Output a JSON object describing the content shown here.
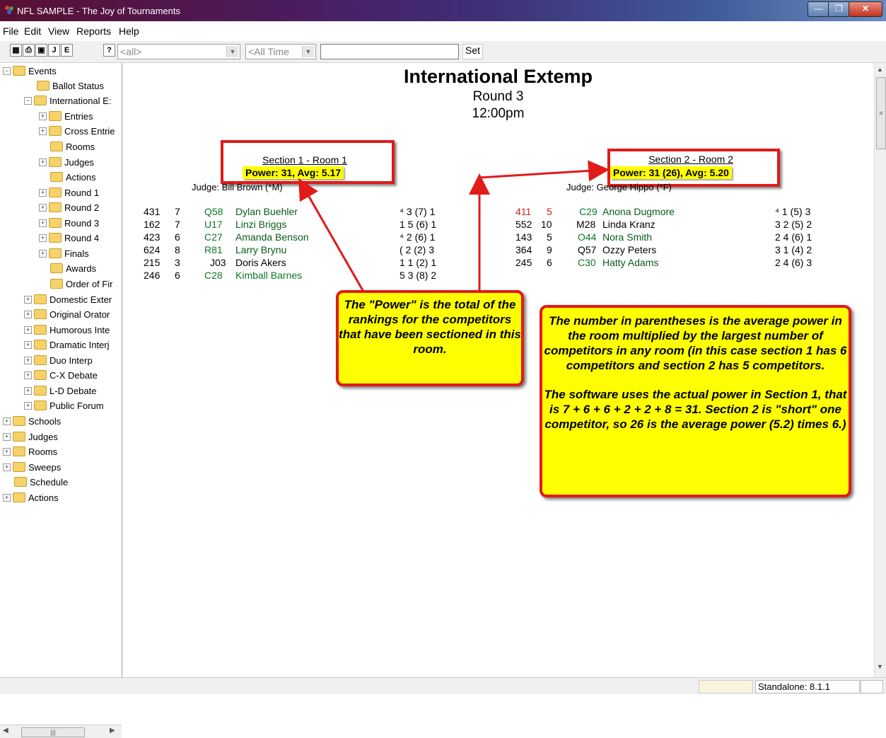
{
  "window": {
    "title": "NFL SAMPLE - The Joy of Tournaments"
  },
  "menu": [
    "File",
    "Edit",
    "View",
    "Reports",
    "Help"
  ],
  "toolbar": {
    "buttons": [
      "save",
      "print",
      "preview",
      "J",
      "E",
      "?"
    ],
    "filter_combo": "<all>",
    "time_combo": "<All Time",
    "set_label": "Set"
  },
  "tree": [
    {
      "label": "Events",
      "expander": "−"
    },
    {
      "label": "Ballot Status"
    },
    {
      "label": "International E:",
      "expander": "−"
    },
    {
      "label": "Entries",
      "expander": "+"
    },
    {
      "label": "Cross Entrie",
      "expander": "+"
    },
    {
      "label": "Rooms"
    },
    {
      "label": "Judges",
      "expander": "+"
    },
    {
      "label": "Actions"
    },
    {
      "label": "Round 1",
      "expander": "+"
    },
    {
      "label": "Round 2",
      "expander": "+"
    },
    {
      "label": "Round 3",
      "expander": "+"
    },
    {
      "label": "Round 4",
      "expander": "+"
    },
    {
      "label": "Finals",
      "expander": "+"
    },
    {
      "label": "Awards"
    },
    {
      "label": "Order of Fir"
    },
    {
      "label": "Domestic Exter",
      "expander": "+"
    },
    {
      "label": "Original Orator",
      "expander": "+"
    },
    {
      "label": "Humorous Inte",
      "expander": "+"
    },
    {
      "label": "Dramatic Interj",
      "expander": "+"
    },
    {
      "label": "Duo Interp",
      "expander": "+"
    },
    {
      "label": "C-X Debate",
      "expander": "+"
    },
    {
      "label": "L-D Debate",
      "expander": "+"
    },
    {
      "label": "Public Forum",
      "expander": "+"
    },
    {
      "label": "Schools",
      "expander": "+"
    },
    {
      "label": "Judges",
      "expander": "+"
    },
    {
      "label": "Rooms",
      "expander": "+"
    },
    {
      "label": "Sweeps",
      "expander": "+"
    },
    {
      "label": "Schedule"
    },
    {
      "label": "Actions",
      "expander": "+"
    }
  ],
  "report": {
    "title": "International Extemp",
    "round": "Round 3",
    "time": "12:00pm",
    "sections": [
      {
        "heading": "Section 1 - Room 1",
        "power": "Power: 31,  Avg: 5.17",
        "judge": "Judge: Bill Brown (*M)",
        "rows": [
          {
            "num": "431",
            "power": "7",
            "code": "Q58",
            "name": "Dylan Buehler",
            "record": "⁴ 3 (7) 1"
          },
          {
            "num": "162",
            "power": "7",
            "code": "U17",
            "name": "Linzi Briggs",
            "record": "1 5 (6) 1"
          },
          {
            "num": "423",
            "power": "6",
            "code": "C27",
            "name": "Amanda Benson",
            "record": "⁴ 2 (6) 1"
          },
          {
            "num": "624",
            "power": "8",
            "code": "R81",
            "name": "Larry Brynu",
            "record": "( 2 (2) 3"
          },
          {
            "num": "215",
            "power": "3",
            "code": "J03",
            "name": "Doris Akers",
            "record": "1 1 (2) 1"
          },
          {
            "num": "246",
            "power": "6",
            "code": "C28",
            "name": "Kimball Barnes",
            "record": "5 3 (8) 2"
          }
        ]
      },
      {
        "heading": "Section 2 - Room 2",
        "power": "Power: 31 (26),  Avg: 5.20",
        "judge": "Judge: George Hippo (*F)",
        "rows": [
          {
            "num": "411",
            "power": "5",
            "code": "C29",
            "name": "Anona Dugmore",
            "record": "⁴ 1 (5) 3"
          },
          {
            "num": "552",
            "power": "10",
            "code": "M28",
            "name": "Linda Kranz",
            "record": "3 2 (5) 2"
          },
          {
            "num": "143",
            "power": "5",
            "code": "O44",
            "name": "Nora Smith",
            "record": "2 4 (6) 1"
          },
          {
            "num": "364",
            "power": "9",
            "code": "Q57",
            "name": "Ozzy Peters",
            "record": "3 1 (4) 2"
          },
          {
            "num": "245",
            "power": "6",
            "code": "C30",
            "name": "Hatty Adams",
            "record": "2 4 (6) 3"
          }
        ]
      }
    ]
  },
  "callouts": {
    "power": "The \"Power\" is the total of the rankings for the competitors that have been sectioned in this room.",
    "parentheses_1": "The number in parentheses is the average power in the room multiplied by the largest number of competitors in any room (in this case section 1 has 6 competitors and section 2 has 5 competitors.",
    "parentheses_2": "The software uses the actual power in Section 1, that is 7 + 6 + 6 + 2 + 2 + 8 = 31.  Section 2 is \"short\" one competitor, so 26 is the average power (5.2) times 6.)"
  },
  "status": {
    "version": "Standalone: 8.1.1"
  },
  "colors": {
    "callout_bg": "#ffff00",
    "callout_border": "#e11a1a",
    "name_green": "#0a7a2a"
  }
}
